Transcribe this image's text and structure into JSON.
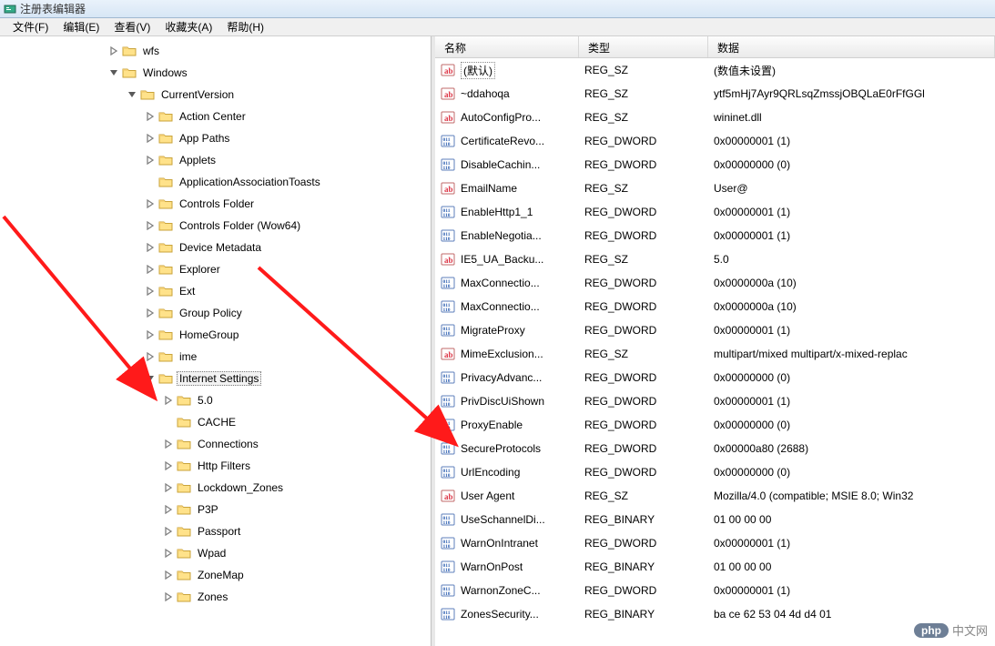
{
  "title": "注册表编辑器",
  "menu": {
    "file": "文件(F)",
    "edit": "编辑(E)",
    "view": "查看(V)",
    "favorites": "收藏夹(A)",
    "help": "帮助(H)"
  },
  "columns": {
    "name": "名称",
    "type": "类型",
    "data": "数据"
  },
  "tree": {
    "item0": "wfs",
    "item1": "Windows",
    "item2": "CurrentVersion",
    "items": [
      "Action Center",
      "App Paths",
      "Applets",
      "ApplicationAssociationToasts",
      "Controls Folder",
      "Controls Folder (Wow64)",
      "Device Metadata",
      "Explorer",
      "Ext",
      "Group Policy",
      "HomeGroup",
      "ime",
      "Internet Settings"
    ],
    "internet_children": [
      "5.0",
      "CACHE",
      "Connections",
      "Http Filters",
      "Lockdown_Zones",
      "P3P",
      "Passport",
      "Wpad",
      "ZoneMap",
      "Zones"
    ]
  },
  "values": [
    {
      "icon": "sz",
      "name": "(默认)",
      "boxed": true,
      "type": "REG_SZ",
      "data": "(数值未设置)"
    },
    {
      "icon": "sz",
      "name": "~ddahoqa",
      "type": "REG_SZ",
      "data": "ytf5mHj7Ayr9QRLsqZmssjOBQLaE0rFfGGl"
    },
    {
      "icon": "sz",
      "name": "AutoConfigPro...",
      "type": "REG_SZ",
      "data": "wininet.dll"
    },
    {
      "icon": "bin",
      "name": "CertificateRevo...",
      "type": "REG_DWORD",
      "data": "0x00000001 (1)"
    },
    {
      "icon": "bin",
      "name": "DisableCachin...",
      "type": "REG_DWORD",
      "data": "0x00000000 (0)"
    },
    {
      "icon": "sz",
      "name": "EmailName",
      "type": "REG_SZ",
      "data": "User@"
    },
    {
      "icon": "bin",
      "name": "EnableHttp1_1",
      "type": "REG_DWORD",
      "data": "0x00000001 (1)"
    },
    {
      "icon": "bin",
      "name": "EnableNegotia...",
      "type": "REG_DWORD",
      "data": "0x00000001 (1)"
    },
    {
      "icon": "sz",
      "name": "IE5_UA_Backu...",
      "type": "REG_SZ",
      "data": "5.0"
    },
    {
      "icon": "bin",
      "name": "MaxConnectio...",
      "type": "REG_DWORD",
      "data": "0x0000000a (10)"
    },
    {
      "icon": "bin",
      "name": "MaxConnectio...",
      "type": "REG_DWORD",
      "data": "0x0000000a (10)"
    },
    {
      "icon": "bin",
      "name": "MigrateProxy",
      "type": "REG_DWORD",
      "data": "0x00000001 (1)"
    },
    {
      "icon": "sz",
      "name": "MimeExclusion...",
      "type": "REG_SZ",
      "data": "multipart/mixed multipart/x-mixed-replac"
    },
    {
      "icon": "bin",
      "name": "PrivacyAdvanc...",
      "type": "REG_DWORD",
      "data": "0x00000000 (0)"
    },
    {
      "icon": "bin",
      "name": "PrivDiscUiShown",
      "type": "REG_DWORD",
      "data": "0x00000001 (1)"
    },
    {
      "icon": "bin",
      "name": "ProxyEnable",
      "type": "REG_DWORD",
      "data": "0x00000000 (0)"
    },
    {
      "icon": "bin",
      "name": "SecureProtocols",
      "type": "REG_DWORD",
      "data": "0x00000a80 (2688)"
    },
    {
      "icon": "bin",
      "name": "UrlEncoding",
      "type": "REG_DWORD",
      "data": "0x00000000 (0)"
    },
    {
      "icon": "sz",
      "name": "User Agent",
      "type": "REG_SZ",
      "data": "Mozilla/4.0 (compatible; MSIE 8.0; Win32"
    },
    {
      "icon": "bin",
      "name": "UseSchannelDi...",
      "type": "REG_BINARY",
      "data": "01 00 00 00"
    },
    {
      "icon": "bin",
      "name": "WarnOnIntranet",
      "type": "REG_DWORD",
      "data": "0x00000001 (1)"
    },
    {
      "icon": "bin",
      "name": "WarnOnPost",
      "type": "REG_BINARY",
      "data": "01 00 00 00"
    },
    {
      "icon": "bin",
      "name": "WarnonZoneC...",
      "type": "REG_DWORD",
      "data": "0x00000001 (1)"
    },
    {
      "icon": "bin",
      "name": "ZonesSecurity...",
      "type": "REG_BINARY",
      "data": "ba ce 62 53 04 4d d4 01"
    }
  ],
  "watermark": {
    "badge": "php",
    "text": "中文网"
  }
}
